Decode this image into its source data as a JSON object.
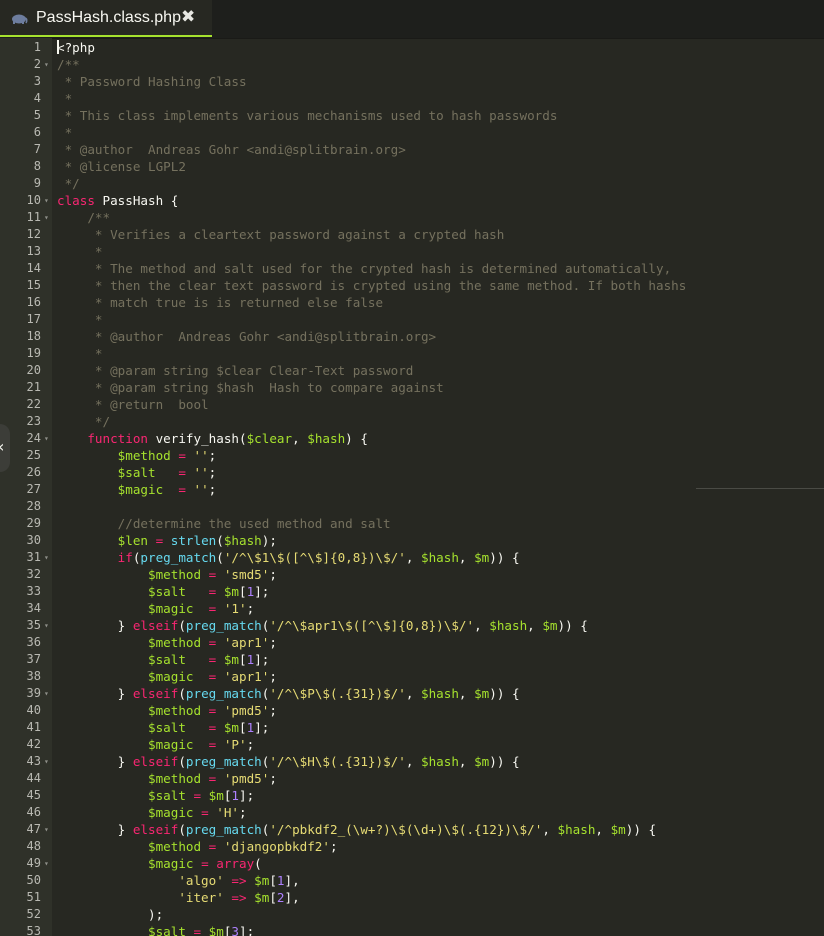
{
  "tab": {
    "label": "PassHash.class.php",
    "icon": "php-elephant-icon",
    "close_glyph": "✖"
  },
  "side_toggle": {
    "glyph": "‹"
  },
  "colors": {
    "background": "#272822",
    "gutter": "#2f3129",
    "comment": "#75715e",
    "keyword": "#f92672",
    "variable": "#a6e22e",
    "function": "#66d9ef",
    "string": "#e6db74",
    "accent": "#a6e22e"
  },
  "editor": {
    "lines": [
      {
        "n": "1",
        "fold": false,
        "seg": [
          [
            "p",
            "<?php"
          ]
        ]
      },
      {
        "n": "2",
        "fold": true,
        "seg": [
          [
            "c",
            "/**"
          ]
        ]
      },
      {
        "n": "3",
        "fold": false,
        "seg": [
          [
            "c",
            " * Password Hashing Class"
          ]
        ]
      },
      {
        "n": "4",
        "fold": false,
        "seg": [
          [
            "c",
            " *"
          ]
        ]
      },
      {
        "n": "5",
        "fold": false,
        "seg": [
          [
            "c",
            " * This class implements various mechanisms used to hash passwords"
          ]
        ]
      },
      {
        "n": "6",
        "fold": false,
        "seg": [
          [
            "c",
            " *"
          ]
        ]
      },
      {
        "n": "7",
        "fold": false,
        "seg": [
          [
            "c",
            " * @author  Andreas Gohr <andi@splitbrain.org>"
          ]
        ]
      },
      {
        "n": "8",
        "fold": false,
        "seg": [
          [
            "c",
            " * @license LGPL2"
          ]
        ]
      },
      {
        "n": "9",
        "fold": false,
        "seg": [
          [
            "c",
            " */"
          ]
        ]
      },
      {
        "n": "10",
        "fold": true,
        "seg": [
          [
            "k",
            "class"
          ],
          [
            "p",
            " PassHash {"
          ]
        ]
      },
      {
        "n": "11",
        "fold": true,
        "seg": [
          [
            "c",
            "    /**"
          ]
        ]
      },
      {
        "n": "12",
        "fold": false,
        "seg": [
          [
            "c",
            "     * Verifies a cleartext password against a crypted hash"
          ]
        ]
      },
      {
        "n": "13",
        "fold": false,
        "seg": [
          [
            "c",
            "     *"
          ]
        ]
      },
      {
        "n": "14",
        "fold": false,
        "seg": [
          [
            "c",
            "     * The method and salt used for the crypted hash is determined automatically,"
          ]
        ]
      },
      {
        "n": "15",
        "fold": false,
        "seg": [
          [
            "c",
            "     * then the clear text password is crypted using the same method. If both hashs"
          ]
        ]
      },
      {
        "n": "16",
        "fold": false,
        "seg": [
          [
            "c",
            "     * match true is is returned else false"
          ]
        ]
      },
      {
        "n": "17",
        "fold": false,
        "seg": [
          [
            "c",
            "     *"
          ]
        ]
      },
      {
        "n": "18",
        "fold": false,
        "seg": [
          [
            "c",
            "     * @author  Andreas Gohr <andi@splitbrain.org>"
          ]
        ]
      },
      {
        "n": "19",
        "fold": false,
        "seg": [
          [
            "c",
            "     *"
          ]
        ]
      },
      {
        "n": "20",
        "fold": false,
        "seg": [
          [
            "c",
            "     * @param string $clear Clear-Text password"
          ]
        ]
      },
      {
        "n": "21",
        "fold": false,
        "seg": [
          [
            "c",
            "     * @param string $hash  Hash to compare against"
          ]
        ]
      },
      {
        "n": "22",
        "fold": false,
        "seg": [
          [
            "c",
            "     * @return  bool"
          ]
        ]
      },
      {
        "n": "23",
        "fold": false,
        "seg": [
          [
            "c",
            "     */"
          ]
        ]
      },
      {
        "n": "24",
        "fold": true,
        "seg": [
          [
            "k",
            "    function"
          ],
          [
            "p",
            " verify_hash("
          ],
          [
            "v",
            "$clear"
          ],
          [
            "p",
            ", "
          ],
          [
            "v",
            "$hash"
          ],
          [
            "p",
            ") {"
          ]
        ]
      },
      {
        "n": "25",
        "fold": false,
        "seg": [
          [
            "v",
            "        $method"
          ],
          [
            "k",
            " ="
          ],
          [
            "s",
            " ''"
          ],
          [
            "p",
            ";"
          ]
        ]
      },
      {
        "n": "26",
        "fold": false,
        "seg": [
          [
            "v",
            "        $salt"
          ],
          [
            "k",
            "   ="
          ],
          [
            "s",
            " ''"
          ],
          [
            "p",
            ";"
          ]
        ]
      },
      {
        "n": "27",
        "fold": false,
        "seg": [
          [
            "v",
            "        $magic"
          ],
          [
            "k",
            "  ="
          ],
          [
            "s",
            " ''"
          ],
          [
            "p",
            ";"
          ]
        ]
      },
      {
        "n": "28",
        "fold": false,
        "seg": [
          [
            "p",
            ""
          ]
        ]
      },
      {
        "n": "29",
        "fold": false,
        "seg": [
          [
            "c",
            "        //determine the used method and salt"
          ]
        ]
      },
      {
        "n": "30",
        "fold": false,
        "seg": [
          [
            "v",
            "        $len"
          ],
          [
            "k",
            " ="
          ],
          [
            "f",
            " strlen"
          ],
          [
            "p",
            "("
          ],
          [
            "v",
            "$hash"
          ],
          [
            "p",
            ");"
          ]
        ]
      },
      {
        "n": "31",
        "fold": true,
        "seg": [
          [
            "k",
            "        if"
          ],
          [
            "p",
            "("
          ],
          [
            "f",
            "preg_match"
          ],
          [
            "p",
            "("
          ],
          [
            "s",
            "'/^\\$1\\$([^\\$]{0,8})\\$/'"
          ],
          [
            "p",
            ", "
          ],
          [
            "v",
            "$hash"
          ],
          [
            "p",
            ", "
          ],
          [
            "v",
            "$m"
          ],
          [
            "p",
            ")) {"
          ]
        ]
      },
      {
        "n": "32",
        "fold": false,
        "seg": [
          [
            "v",
            "            $method"
          ],
          [
            "k",
            " ="
          ],
          [
            "s",
            " 'smd5'"
          ],
          [
            "p",
            ";"
          ]
        ]
      },
      {
        "n": "33",
        "fold": false,
        "seg": [
          [
            "v",
            "            $salt"
          ],
          [
            "k",
            "   ="
          ],
          [
            "v",
            " $m"
          ],
          [
            "p",
            "["
          ],
          [
            "n",
            "1"
          ],
          [
            "p",
            "];"
          ]
        ]
      },
      {
        "n": "34",
        "fold": false,
        "seg": [
          [
            "v",
            "            $magic"
          ],
          [
            "k",
            "  ="
          ],
          [
            "s",
            " '1'"
          ],
          [
            "p",
            ";"
          ]
        ]
      },
      {
        "n": "35",
        "fold": true,
        "seg": [
          [
            "p",
            "        } "
          ],
          [
            "k",
            "elseif"
          ],
          [
            "p",
            "("
          ],
          [
            "f",
            "preg_match"
          ],
          [
            "p",
            "("
          ],
          [
            "s",
            "'/^\\$apr1\\$([^\\$]{0,8})\\$/'"
          ],
          [
            "p",
            ", "
          ],
          [
            "v",
            "$hash"
          ],
          [
            "p",
            ", "
          ],
          [
            "v",
            "$m"
          ],
          [
            "p",
            ")) {"
          ]
        ]
      },
      {
        "n": "36",
        "fold": false,
        "seg": [
          [
            "v",
            "            $method"
          ],
          [
            "k",
            " ="
          ],
          [
            "s",
            " 'apr1'"
          ],
          [
            "p",
            ";"
          ]
        ]
      },
      {
        "n": "37",
        "fold": false,
        "seg": [
          [
            "v",
            "            $salt"
          ],
          [
            "k",
            "   ="
          ],
          [
            "v",
            " $m"
          ],
          [
            "p",
            "["
          ],
          [
            "n",
            "1"
          ],
          [
            "p",
            "];"
          ]
        ]
      },
      {
        "n": "38",
        "fold": false,
        "seg": [
          [
            "v",
            "            $magic"
          ],
          [
            "k",
            "  ="
          ],
          [
            "s",
            " 'apr1'"
          ],
          [
            "p",
            ";"
          ]
        ]
      },
      {
        "n": "39",
        "fold": true,
        "seg": [
          [
            "p",
            "        } "
          ],
          [
            "k",
            "elseif"
          ],
          [
            "p",
            "("
          ],
          [
            "f",
            "preg_match"
          ],
          [
            "p",
            "("
          ],
          [
            "s",
            "'/^\\$P\\$(.{31})$/'"
          ],
          [
            "p",
            ", "
          ],
          [
            "v",
            "$hash"
          ],
          [
            "p",
            ", "
          ],
          [
            "v",
            "$m"
          ],
          [
            "p",
            ")) {"
          ]
        ]
      },
      {
        "n": "40",
        "fold": false,
        "seg": [
          [
            "v",
            "            $method"
          ],
          [
            "k",
            " ="
          ],
          [
            "s",
            " 'pmd5'"
          ],
          [
            "p",
            ";"
          ]
        ]
      },
      {
        "n": "41",
        "fold": false,
        "seg": [
          [
            "v",
            "            $salt"
          ],
          [
            "k",
            "   ="
          ],
          [
            "v",
            " $m"
          ],
          [
            "p",
            "["
          ],
          [
            "n",
            "1"
          ],
          [
            "p",
            "];"
          ]
        ]
      },
      {
        "n": "42",
        "fold": false,
        "seg": [
          [
            "v",
            "            $magic"
          ],
          [
            "k",
            "  ="
          ],
          [
            "s",
            " 'P'"
          ],
          [
            "p",
            ";"
          ]
        ]
      },
      {
        "n": "43",
        "fold": true,
        "seg": [
          [
            "p",
            "        } "
          ],
          [
            "k",
            "elseif"
          ],
          [
            "p",
            "("
          ],
          [
            "f",
            "preg_match"
          ],
          [
            "p",
            "("
          ],
          [
            "s",
            "'/^\\$H\\$(.{31})$/'"
          ],
          [
            "p",
            ", "
          ],
          [
            "v",
            "$hash"
          ],
          [
            "p",
            ", "
          ],
          [
            "v",
            "$m"
          ],
          [
            "p",
            ")) {"
          ]
        ]
      },
      {
        "n": "44",
        "fold": false,
        "seg": [
          [
            "v",
            "            $method"
          ],
          [
            "k",
            " ="
          ],
          [
            "s",
            " 'pmd5'"
          ],
          [
            "p",
            ";"
          ]
        ]
      },
      {
        "n": "45",
        "fold": false,
        "seg": [
          [
            "v",
            "            $salt"
          ],
          [
            "k",
            " ="
          ],
          [
            "v",
            " $m"
          ],
          [
            "p",
            "["
          ],
          [
            "n",
            "1"
          ],
          [
            "p",
            "];"
          ]
        ]
      },
      {
        "n": "46",
        "fold": false,
        "seg": [
          [
            "v",
            "            $magic"
          ],
          [
            "k",
            " ="
          ],
          [
            "s",
            " 'H'"
          ],
          [
            "p",
            ";"
          ]
        ]
      },
      {
        "n": "47",
        "fold": true,
        "seg": [
          [
            "p",
            "        } "
          ],
          [
            "k",
            "elseif"
          ],
          [
            "p",
            "("
          ],
          [
            "f",
            "preg_match"
          ],
          [
            "p",
            "("
          ],
          [
            "s",
            "'/^pbkdf2_(\\w+?)\\$(\\d+)\\$(.{12})\\$/'"
          ],
          [
            "p",
            ", "
          ],
          [
            "v",
            "$hash"
          ],
          [
            "p",
            ", "
          ],
          [
            "v",
            "$m"
          ],
          [
            "p",
            ")) {"
          ]
        ]
      },
      {
        "n": "48",
        "fold": false,
        "seg": [
          [
            "v",
            "            $method"
          ],
          [
            "k",
            " ="
          ],
          [
            "s",
            " 'djangopbkdf2'"
          ],
          [
            "p",
            ";"
          ]
        ]
      },
      {
        "n": "49",
        "fold": true,
        "seg": [
          [
            "v",
            "            $magic"
          ],
          [
            "k",
            " ="
          ],
          [
            "k",
            " array"
          ],
          [
            "p",
            "("
          ]
        ]
      },
      {
        "n": "50",
        "fold": false,
        "seg": [
          [
            "s",
            "                'algo'"
          ],
          [
            "k",
            " =>"
          ],
          [
            "v",
            " $m"
          ],
          [
            "p",
            "["
          ],
          [
            "n",
            "1"
          ],
          [
            "p",
            "],"
          ]
        ]
      },
      {
        "n": "51",
        "fold": false,
        "seg": [
          [
            "s",
            "                'iter'"
          ],
          [
            "k",
            " =>"
          ],
          [
            "v",
            " $m"
          ],
          [
            "p",
            "["
          ],
          [
            "n",
            "2"
          ],
          [
            "p",
            "],"
          ]
        ]
      },
      {
        "n": "52",
        "fold": false,
        "seg": [
          [
            "p",
            "            );"
          ]
        ]
      },
      {
        "n": "53",
        "fold": false,
        "seg": [
          [
            "v",
            "            $salt"
          ],
          [
            "k",
            " ="
          ],
          [
            "v",
            " $m"
          ],
          [
            "p",
            "["
          ],
          [
            "n",
            "3"
          ],
          [
            "p",
            "];"
          ]
        ]
      }
    ]
  }
}
